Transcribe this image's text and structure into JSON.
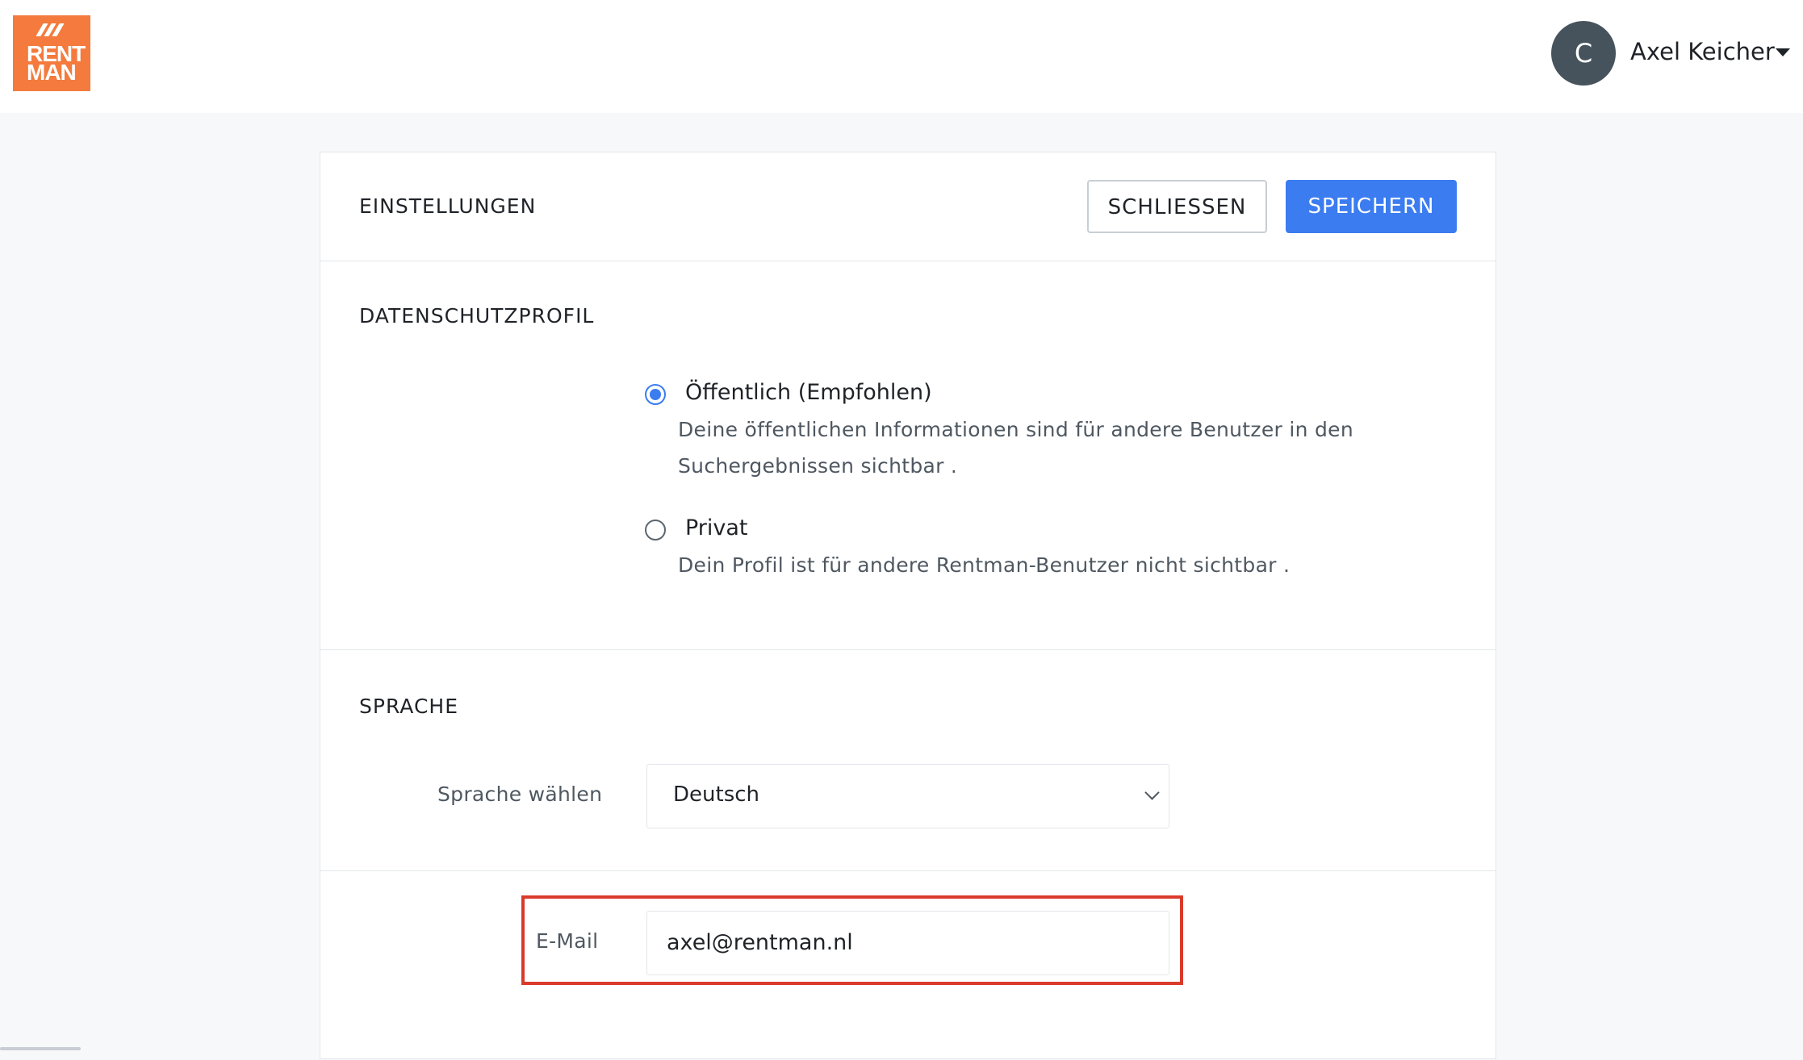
{
  "header": {
    "logo": {
      "line1": "RENT",
      "line2": "MAN"
    },
    "user": {
      "avatar_initial": "C",
      "name": "Axel Keicher"
    }
  },
  "settings": {
    "title": "EINSTELLUNGEN",
    "close_label": "SCHLIESSEN",
    "save_label": "SPEICHERN",
    "privacy": {
      "title": "DATENSCHUTZPROFIL",
      "options": [
        {
          "label": "Öffentlich (Empfohlen)",
          "description_line1": "Deine öffentlichen Informationen sind für andere Benutzer in den",
          "description_line2": "Suchergebnissen sichtbar .",
          "selected": true
        },
        {
          "label": "Privat",
          "description_line1": "Dein Profil ist für andere Rentman-Benutzer nicht sichtbar .",
          "selected": false
        }
      ]
    },
    "language": {
      "title": "SPRACHE",
      "label": "Sprache wählen",
      "selected": "Deutsch"
    },
    "email": {
      "label": "E-Mail",
      "value": "axel@rentman.nl"
    }
  },
  "colors": {
    "accent": "#3b7cf0",
    "brand": "#f47b3d",
    "highlight": "#d93a2b"
  }
}
